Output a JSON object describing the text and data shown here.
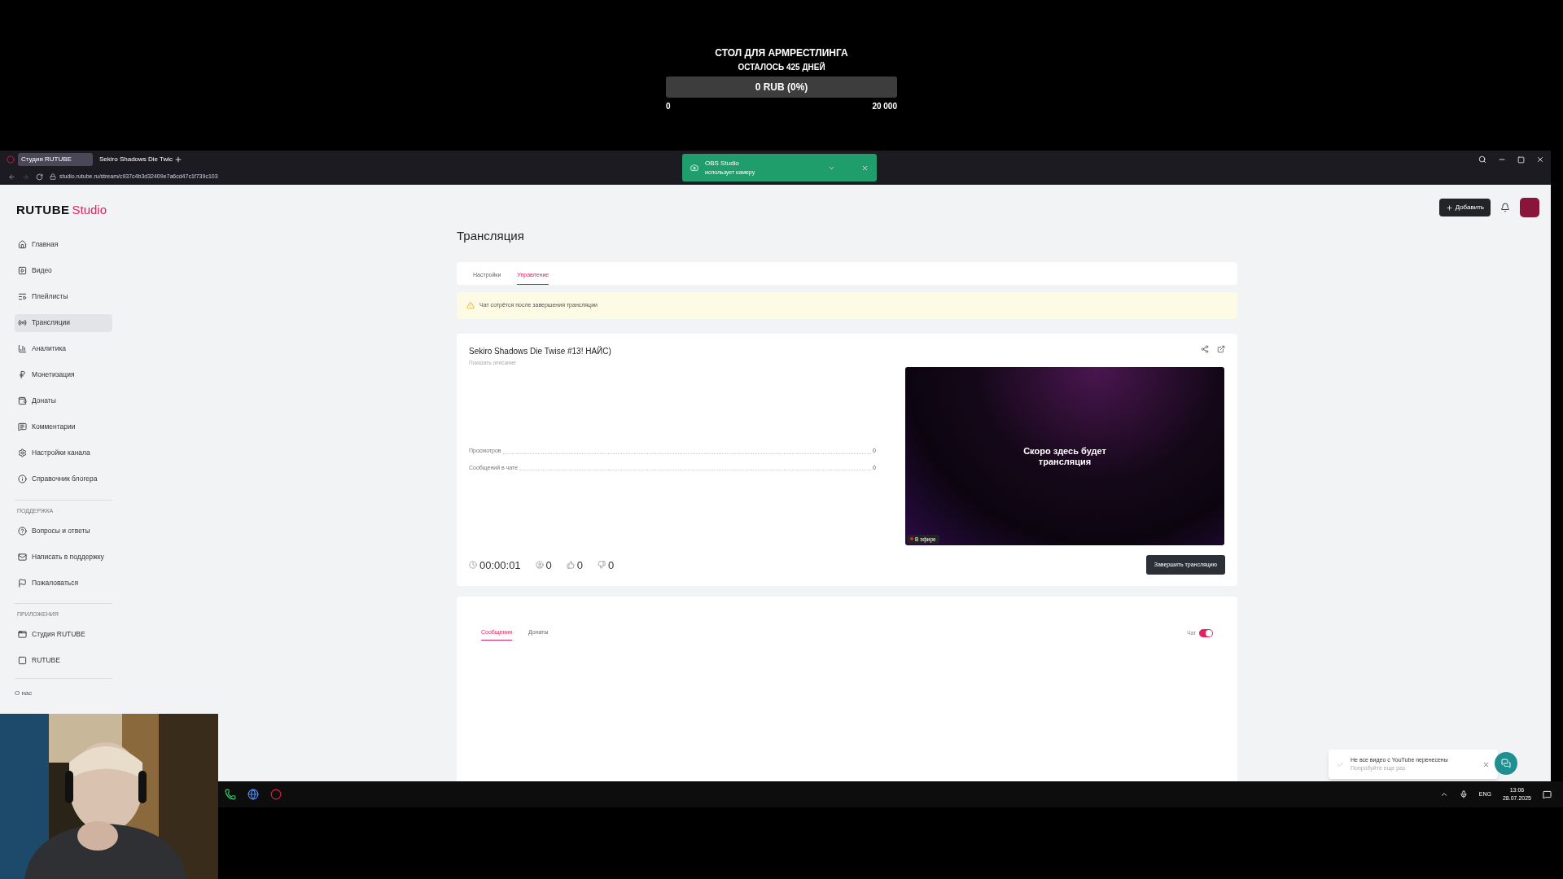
{
  "goal": {
    "title": "СТОЛ ДЛЯ АРМРЕСТЛИНГА",
    "subtitle": "ОСТАЛОСЬ 425 ДНЕЙ",
    "bar_label": "0 RUB (0%)",
    "level": 0,
    "min": "0",
    "max": "20 000"
  },
  "browser": {
    "tabs": [
      {
        "label": "Студия RUTUBE",
        "selected": true
      },
      {
        "label": "Sekiro Shadows Die Twic",
        "selected": false
      }
    ],
    "url": "studio.rutube.ru/stream/c937c4b3d32409e7a6cd47c1f739c103"
  },
  "obs_notification": {
    "title": "OBS Studio",
    "text": "использует камеру"
  },
  "sidebar": {
    "logo_main": "RUTUBE",
    "logo_sub": "Studio",
    "sections": [
      {
        "items": [
          {
            "label": "Главная",
            "selected": false
          },
          {
            "label": "Видео",
            "selected": false
          },
          {
            "label": "Плейлисты",
            "selected": false
          },
          {
            "label": "Трансляции",
            "selected": true
          },
          {
            "label": "Аналитика",
            "selected": false
          },
          {
            "label": "Монетизация",
            "selected": false
          },
          {
            "label": "Донаты",
            "selected": false
          },
          {
            "label": "Комментарии",
            "selected": false
          },
          {
            "label": "Настройки канала",
            "selected": false
          },
          {
            "label": "Справочник блогера",
            "selected": false
          }
        ]
      },
      {
        "heading": "ПОДДЕРЖКА",
        "items": [
          {
            "label": "Вопросы и ответы",
            "selected": false
          },
          {
            "label": "Написать в поддержку",
            "selected": false
          },
          {
            "label": "Пожаловаться",
            "selected": false
          }
        ]
      },
      {
        "heading": "ПРИЛОЖЕНИЯ",
        "items": [
          {
            "label": "Студия RUTUBE",
            "selected": false
          },
          {
            "label": "RUTUBE",
            "selected": false
          }
        ]
      }
    ],
    "footer": "О нас"
  },
  "header": {
    "add_button": "Добавить"
  },
  "page": {
    "title": "Трансляция",
    "tabs": [
      {
        "label": "Настройки",
        "selected": false
      },
      {
        "label": "Управление",
        "selected": true
      }
    ],
    "alert": "Чат сотрётся после завершения трансляции",
    "stream": {
      "title": "Sekiro Shadows Die Twise #13! НАЙС)",
      "show_description": "Показать описание",
      "stats": [
        {
          "label": "Просмотров",
          "value": "0"
        },
        {
          "label": "Сообщений в чате",
          "value": "0"
        }
      ],
      "preview_text": "Скоро здесь будет трансляция",
      "live_badge": "В эфире",
      "metrics": [
        "00:00:01",
        "0",
        "0",
        "0"
      ],
      "end_button": "Завершить трансляцию"
    },
    "chat": {
      "tabs": [
        {
          "label": "Сообщения",
          "selected": true
        },
        {
          "label": "Донаты",
          "selected": false
        }
      ],
      "toggle_label": "Чат",
      "toggle_on": true
    }
  },
  "toast": {
    "title": "Не все видео с YouTube перенесены",
    "subtitle": "Попробуйте еще раз"
  },
  "taskbar": {
    "language": "ENG",
    "time": "13:06",
    "date": "28.07.2025"
  }
}
